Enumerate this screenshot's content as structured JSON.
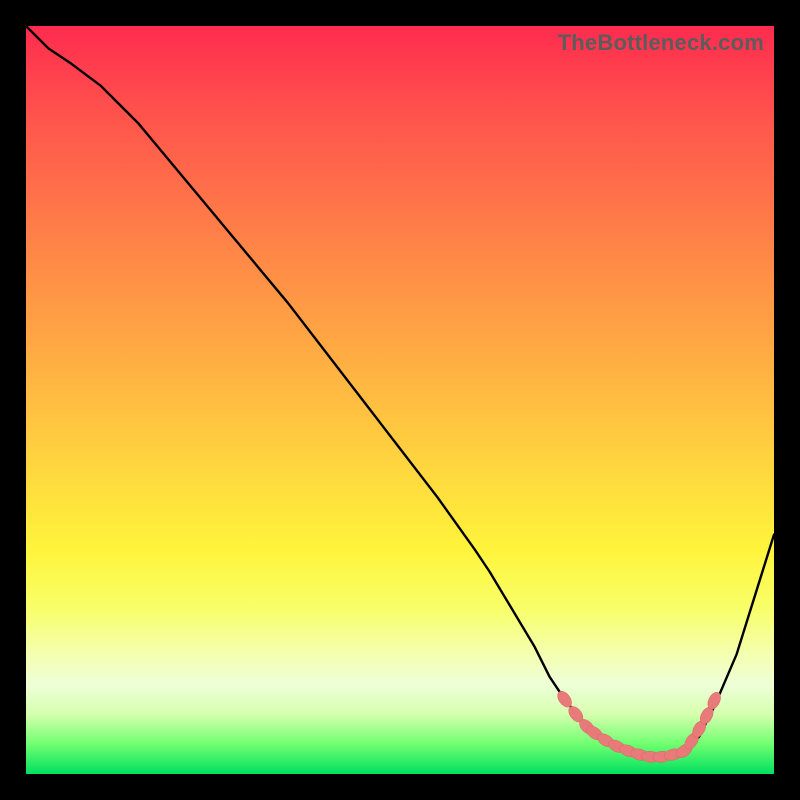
{
  "watermark": "TheBottleneck.com",
  "chart_data": {
    "type": "line",
    "title": "",
    "xlabel": "",
    "ylabel": "",
    "xlim": [
      0,
      100
    ],
    "ylim": [
      0,
      100
    ],
    "series": [
      {
        "name": "curve",
        "x": [
          0,
          3,
          6,
          10,
          15,
          20,
          25,
          30,
          35,
          40,
          45,
          50,
          55,
          60,
          62,
          65,
          68,
          70,
          72,
          74,
          76,
          78,
          80,
          82,
          84,
          86,
          88,
          90,
          92,
          95,
          100
        ],
        "values": [
          100,
          97,
          95,
          92,
          87,
          81,
          75,
          69,
          63,
          56.5,
          50,
          43.5,
          37,
          30,
          27,
          22,
          17,
          13,
          10,
          7.5,
          5.5,
          4,
          3,
          2.3,
          2,
          2.3,
          3,
          5,
          9,
          16,
          32
        ]
      }
    ],
    "markers": {
      "name": "highlight-dots",
      "points": [
        {
          "x": 72,
          "y": 10
        },
        {
          "x": 73.5,
          "y": 8
        },
        {
          "x": 75,
          "y": 6.3
        },
        {
          "x": 76,
          "y": 5.5
        },
        {
          "x": 77.5,
          "y": 4.5
        },
        {
          "x": 79,
          "y": 3.7
        },
        {
          "x": 80.5,
          "y": 3.1
        },
        {
          "x": 82,
          "y": 2.6
        },
        {
          "x": 83.5,
          "y": 2.3
        },
        {
          "x": 85,
          "y": 2.3
        },
        {
          "x": 86.5,
          "y": 2.6
        },
        {
          "x": 88,
          "y": 3.1
        },
        {
          "x": 89,
          "y": 4.4
        },
        {
          "x": 90,
          "y": 6
        },
        {
          "x": 91,
          "y": 7.8
        },
        {
          "x": 92,
          "y": 9.8
        }
      ]
    },
    "gradient_stops": [
      {
        "pct": 0,
        "color": "#ff2b4f"
      },
      {
        "pct": 50,
        "color": "#ffbd41"
      },
      {
        "pct": 78,
        "color": "#f8ff6a"
      },
      {
        "pct": 100,
        "color": "#00e060"
      }
    ]
  }
}
